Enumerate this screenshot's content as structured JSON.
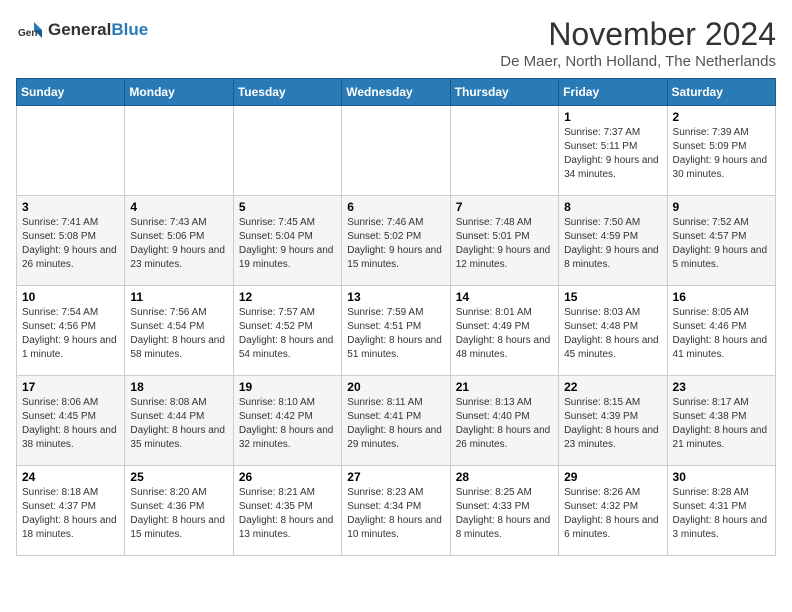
{
  "logo": {
    "general": "General",
    "blue": "Blue"
  },
  "header": {
    "month": "November 2024",
    "location": "De Maer, North Holland, The Netherlands"
  },
  "weekdays": [
    "Sunday",
    "Monday",
    "Tuesday",
    "Wednesday",
    "Thursday",
    "Friday",
    "Saturday"
  ],
  "weeks": [
    [
      {
        "day": "",
        "info": ""
      },
      {
        "day": "",
        "info": ""
      },
      {
        "day": "",
        "info": ""
      },
      {
        "day": "",
        "info": ""
      },
      {
        "day": "",
        "info": ""
      },
      {
        "day": "1",
        "info": "Sunrise: 7:37 AM\nSunset: 5:11 PM\nDaylight: 9 hours and 34 minutes."
      },
      {
        "day": "2",
        "info": "Sunrise: 7:39 AM\nSunset: 5:09 PM\nDaylight: 9 hours and 30 minutes."
      }
    ],
    [
      {
        "day": "3",
        "info": "Sunrise: 7:41 AM\nSunset: 5:08 PM\nDaylight: 9 hours and 26 minutes."
      },
      {
        "day": "4",
        "info": "Sunrise: 7:43 AM\nSunset: 5:06 PM\nDaylight: 9 hours and 23 minutes."
      },
      {
        "day": "5",
        "info": "Sunrise: 7:45 AM\nSunset: 5:04 PM\nDaylight: 9 hours and 19 minutes."
      },
      {
        "day": "6",
        "info": "Sunrise: 7:46 AM\nSunset: 5:02 PM\nDaylight: 9 hours and 15 minutes."
      },
      {
        "day": "7",
        "info": "Sunrise: 7:48 AM\nSunset: 5:01 PM\nDaylight: 9 hours and 12 minutes."
      },
      {
        "day": "8",
        "info": "Sunrise: 7:50 AM\nSunset: 4:59 PM\nDaylight: 9 hours and 8 minutes."
      },
      {
        "day": "9",
        "info": "Sunrise: 7:52 AM\nSunset: 4:57 PM\nDaylight: 9 hours and 5 minutes."
      }
    ],
    [
      {
        "day": "10",
        "info": "Sunrise: 7:54 AM\nSunset: 4:56 PM\nDaylight: 9 hours and 1 minute."
      },
      {
        "day": "11",
        "info": "Sunrise: 7:56 AM\nSunset: 4:54 PM\nDaylight: 8 hours and 58 minutes."
      },
      {
        "day": "12",
        "info": "Sunrise: 7:57 AM\nSunset: 4:52 PM\nDaylight: 8 hours and 54 minutes."
      },
      {
        "day": "13",
        "info": "Sunrise: 7:59 AM\nSunset: 4:51 PM\nDaylight: 8 hours and 51 minutes."
      },
      {
        "day": "14",
        "info": "Sunrise: 8:01 AM\nSunset: 4:49 PM\nDaylight: 8 hours and 48 minutes."
      },
      {
        "day": "15",
        "info": "Sunrise: 8:03 AM\nSunset: 4:48 PM\nDaylight: 8 hours and 45 minutes."
      },
      {
        "day": "16",
        "info": "Sunrise: 8:05 AM\nSunset: 4:46 PM\nDaylight: 8 hours and 41 minutes."
      }
    ],
    [
      {
        "day": "17",
        "info": "Sunrise: 8:06 AM\nSunset: 4:45 PM\nDaylight: 8 hours and 38 minutes."
      },
      {
        "day": "18",
        "info": "Sunrise: 8:08 AM\nSunset: 4:44 PM\nDaylight: 8 hours and 35 minutes."
      },
      {
        "day": "19",
        "info": "Sunrise: 8:10 AM\nSunset: 4:42 PM\nDaylight: 8 hours and 32 minutes."
      },
      {
        "day": "20",
        "info": "Sunrise: 8:11 AM\nSunset: 4:41 PM\nDaylight: 8 hours and 29 minutes."
      },
      {
        "day": "21",
        "info": "Sunrise: 8:13 AM\nSunset: 4:40 PM\nDaylight: 8 hours and 26 minutes."
      },
      {
        "day": "22",
        "info": "Sunrise: 8:15 AM\nSunset: 4:39 PM\nDaylight: 8 hours and 23 minutes."
      },
      {
        "day": "23",
        "info": "Sunrise: 8:17 AM\nSunset: 4:38 PM\nDaylight: 8 hours and 21 minutes."
      }
    ],
    [
      {
        "day": "24",
        "info": "Sunrise: 8:18 AM\nSunset: 4:37 PM\nDaylight: 8 hours and 18 minutes."
      },
      {
        "day": "25",
        "info": "Sunrise: 8:20 AM\nSunset: 4:36 PM\nDaylight: 8 hours and 15 minutes."
      },
      {
        "day": "26",
        "info": "Sunrise: 8:21 AM\nSunset: 4:35 PM\nDaylight: 8 hours and 13 minutes."
      },
      {
        "day": "27",
        "info": "Sunrise: 8:23 AM\nSunset: 4:34 PM\nDaylight: 8 hours and 10 minutes."
      },
      {
        "day": "28",
        "info": "Sunrise: 8:25 AM\nSunset: 4:33 PM\nDaylight: 8 hours and 8 minutes."
      },
      {
        "day": "29",
        "info": "Sunrise: 8:26 AM\nSunset: 4:32 PM\nDaylight: 8 hours and 6 minutes."
      },
      {
        "day": "30",
        "info": "Sunrise: 8:28 AM\nSunset: 4:31 PM\nDaylight: 8 hours and 3 minutes."
      }
    ]
  ]
}
